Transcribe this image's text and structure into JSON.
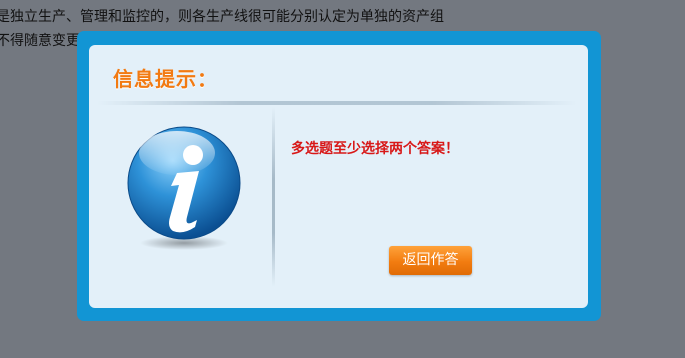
{
  "background": {
    "line1": "是独立生产、管理和监控的，则各生产线很可能分别认定为单独的资产组",
    "line2": "不得随意变更"
  },
  "dialog": {
    "title": "信息提示：",
    "message": "多选题至少选择两个答案！",
    "return_button_label": "返回作答",
    "icon": "info-icon"
  },
  "colors": {
    "overlay": "#737880",
    "frame": "#1295d4",
    "panel": "#e3f0f9",
    "title": "#f27a12",
    "message": "#d81818",
    "button": "#f27c10"
  }
}
